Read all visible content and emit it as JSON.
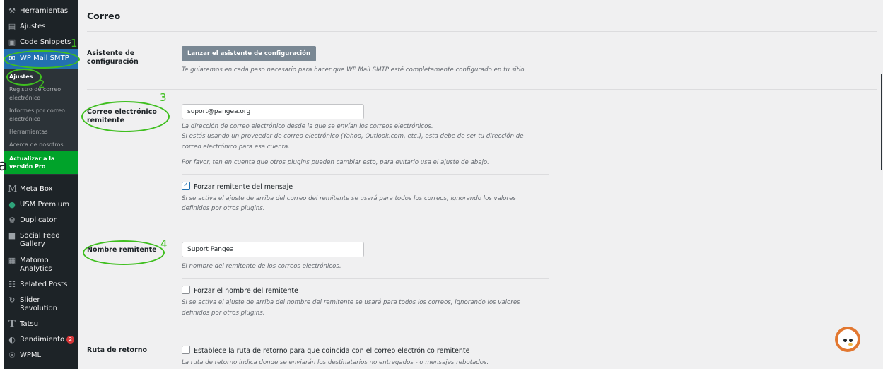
{
  "sidebar": {
    "items_top": [
      {
        "icon": "wrench-icon",
        "glyph": "⚒",
        "label": "Herramientas"
      },
      {
        "icon": "settings-icon",
        "glyph": "▤",
        "label": "Ajustes"
      },
      {
        "icon": "code-icon",
        "glyph": "▣",
        "label": "Code Snippets"
      }
    ],
    "active_item": {
      "icon": "mail-icon",
      "glyph": "✉",
      "label": "WP Mail SMTP"
    },
    "submenu": [
      {
        "label": "Ajustes"
      },
      {
        "label": "Registro de correo electrónico"
      },
      {
        "label": "Informes por correo electrónico"
      },
      {
        "label": "Herramientas"
      },
      {
        "label": "Acerca de nosotros"
      }
    ],
    "upgrade": {
      "label": "Actualizar a la versión Pro"
    },
    "items_bottom": [
      {
        "icon": "metabox-icon",
        "glyph": "M",
        "label": "Meta Box"
      },
      {
        "icon": "usm-icon",
        "glyph": "●",
        "label": "USM Premium"
      },
      {
        "icon": "duplicator-icon",
        "glyph": "⚙",
        "label": "Duplicator"
      },
      {
        "icon": "camera-icon",
        "glyph": "■",
        "label": "Social Feed Gallery"
      },
      {
        "icon": "matomo-icon",
        "glyph": "▦",
        "label": "Matomo Analytics"
      },
      {
        "icon": "grid-icon",
        "glyph": "☷",
        "label": "Related Posts"
      },
      {
        "icon": "slider-icon",
        "glyph": "↻",
        "label": "Slider Revolution"
      },
      {
        "icon": "tatsu-icon",
        "glyph": "T",
        "label": "Tatsu"
      },
      {
        "icon": "performance-icon",
        "glyph": "◐",
        "label": "Rendimiento",
        "badge": "2"
      },
      {
        "icon": "wpml-icon",
        "glyph": "☉",
        "label": "WPML"
      }
    ]
  },
  "annotations": [
    "1",
    "2",
    "3",
    "4"
  ],
  "partial_letter": "a",
  "colors": {
    "accent": "#2271b1",
    "annotation": "#3fbf1f",
    "upgrade": "#00a32a"
  },
  "section": {
    "title": "Correo",
    "wizard": {
      "label": "Asistente de configuración",
      "button": "Lanzar el asistente de configuración",
      "description": "Te guiaremos en cada paso necesario para hacer que WP Mail SMTP esté completamente configurado en tu sitio."
    },
    "from_email": {
      "label": "Correo electrónico remitente",
      "value": "suport@pangea.org",
      "desc1": "La dirección de correo electrónico desde la que se envían los correos electrónicos.",
      "desc2": "Si estás usando un proveedor de correo electrónico (Yahoo, Outlook.com, etc.), esta debe de ser tu dirección de",
      "desc3": "correo electrónico para esa cuenta.",
      "desc4": "Por favor, ten en cuenta que otros plugins pueden cambiar esto, para evitarlo usa el ajuste de abajo.",
      "force_label": "Forzar remitente del mensaje",
      "force_checked": true,
      "force_desc1": "Si se activa el ajuste de arriba del correo del remitente se usará para todos los correos, ignorando los valores",
      "force_desc2": "definidos por otros plugins."
    },
    "from_name": {
      "label": "Nombre remitente",
      "value": "Suport Pangea",
      "desc": "El nombre del remitente de los correos electrónicos.",
      "force_label": "Forzar el nombre del remitente",
      "force_checked": false,
      "force_desc1": "Si se activa el ajuste de arriba del nombre del remitente se usará para todos los correos, ignorando los valores",
      "force_desc2": "definidos por otros plugins."
    },
    "return_path": {
      "label": "Ruta de retorno",
      "check_label": "Establece la ruta de retorno para que coincida con el correo electrónico remitente",
      "checked": false,
      "desc": "La ruta de retorno indica donde se enviarán los destinatarios no entregados - o mensajes rebotados."
    }
  }
}
